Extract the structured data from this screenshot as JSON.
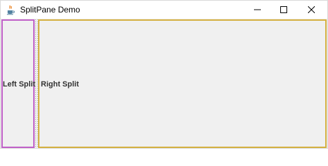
{
  "window": {
    "title": "SplitPane Demo",
    "app_icon": "java-cup-icon",
    "controls": [
      "minimize-icon",
      "maximize-icon",
      "close-icon"
    ]
  },
  "split_pane": {
    "left_label": "Left Split",
    "right_label": "Right Split",
    "left_border_color": "#c060c8",
    "right_border_color": "#d4b040"
  }
}
